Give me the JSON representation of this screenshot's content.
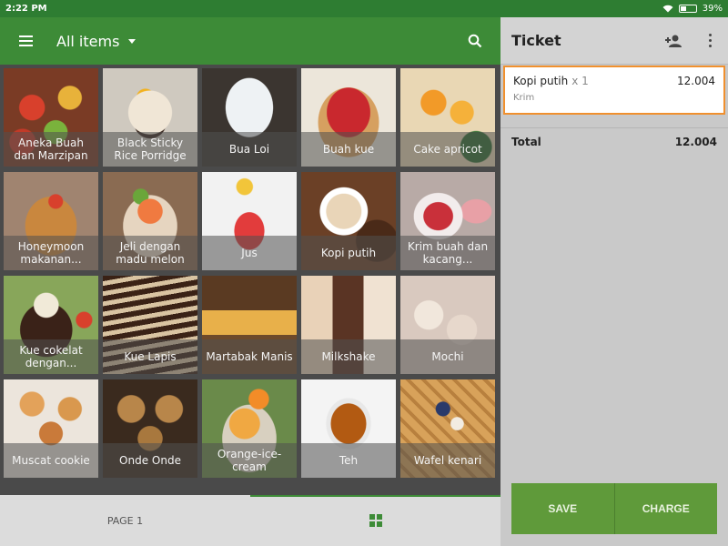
{
  "status": {
    "time": "2:22 PM",
    "battery": "39%"
  },
  "header": {
    "category": "All items"
  },
  "items": [
    {
      "name": "Aneka Buah dan Marzipan"
    },
    {
      "name": "Black Sticky Rice Porridge"
    },
    {
      "name": "Bua Loi"
    },
    {
      "name": "Buah kue"
    },
    {
      "name": "Cake apricot"
    },
    {
      "name": "Honeymoon makanan..."
    },
    {
      "name": "Jeli dengan madu melon"
    },
    {
      "name": "Jus"
    },
    {
      "name": "Kopi putih"
    },
    {
      "name": "Krim buah dan kacang..."
    },
    {
      "name": "Kue cokelat dengan..."
    },
    {
      "name": "Kue Lapis"
    },
    {
      "name": "Martabak Manis"
    },
    {
      "name": "Milkshake"
    },
    {
      "name": "Mochi"
    },
    {
      "name": "Muscat cookie"
    },
    {
      "name": "Onde Onde"
    },
    {
      "name": "Orange-ice-cream"
    },
    {
      "name": "Teh"
    },
    {
      "name": "Wafel kenari"
    }
  ],
  "footer": {
    "page_label": "PAGE 1"
  },
  "ticket": {
    "title": "Ticket",
    "lines": [
      {
        "name": "Kopi putih",
        "qty": "x 1",
        "price": "12.004",
        "modifier": "Krim"
      }
    ],
    "total_label": "Total",
    "total": "12.004",
    "save_label": "SAVE",
    "charge_label": "CHARGE"
  },
  "colors": {
    "primary": "#3d8b37",
    "highlight": "#f0902e",
    "button": "#5f9a3a"
  },
  "icons": {
    "menu": "hamburger-icon",
    "dropdown": "caret-down-icon",
    "search": "search-icon",
    "add_customer": "add-person-icon",
    "more": "more-vert-icon",
    "grid": "grid-icon",
    "wifi": "wifi-icon",
    "battery": "battery-icon"
  }
}
